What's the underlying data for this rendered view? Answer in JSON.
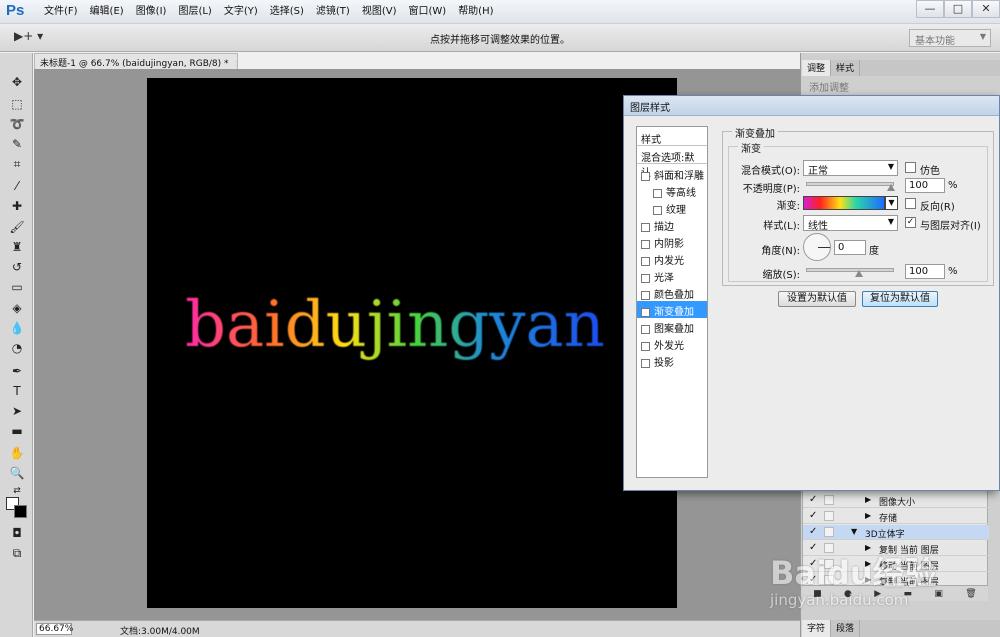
{
  "app": {
    "logo": "Ps",
    "menus": [
      "文件(F)",
      "编辑(E)",
      "图像(I)",
      "图层(L)",
      "文字(Y)",
      "选择(S)",
      "滤镜(T)",
      "视图(V)",
      "窗口(W)",
      "帮助(H)"
    ],
    "window_controls": [
      "—",
      "□",
      "✕"
    ]
  },
  "options_bar": {
    "move_tool": "▶+ ▾",
    "hint": "点按并拖移可调整效果的位置。",
    "workspace": "基本功能"
  },
  "document": {
    "tab_title": "未标题-1 @ 66.7% (baidujingyan, RGB/8) *",
    "canvas_text": "baidujingyan",
    "zoom": "66.67%",
    "doc_info": "文档:3.00M/4.00M"
  },
  "panels": {
    "top_tabs": [
      "调整",
      "样式"
    ],
    "add_adjustment": "添加调整",
    "bottom_tabs": [
      "字符",
      "段落"
    ]
  },
  "actions": {
    "rows": [
      {
        "label": "图像大小",
        "checked": "✓",
        "indent": "1"
      },
      {
        "label": "存储",
        "checked": "✓",
        "indent": "1"
      },
      {
        "label": "3D立体字",
        "checked": "✓",
        "indent": "0"
      },
      {
        "label": "复制 当前 图层",
        "checked": "✓",
        "indent": "1"
      },
      {
        "label": "移动 当前 图层",
        "checked": "✓",
        "indent": "1"
      },
      {
        "label": "复制 当前 图层",
        "checked": "✓",
        "indent": "1"
      }
    ],
    "toolbar_icons": [
      "■",
      "●",
      "▶",
      "▬",
      "▣",
      "🗑"
    ]
  },
  "dialog": {
    "title": "图层样式",
    "list_header": "样式",
    "blend_options": "混合选项:默认",
    "effects": [
      {
        "label": "斜面和浮雕",
        "checked": false,
        "sub": false
      },
      {
        "label": "等高线",
        "checked": false,
        "sub": true
      },
      {
        "label": "纹理",
        "checked": false,
        "sub": true
      },
      {
        "label": "描边",
        "checked": false,
        "sub": false
      },
      {
        "label": "内阴影",
        "checked": false,
        "sub": false
      },
      {
        "label": "内发光",
        "checked": false,
        "sub": false
      },
      {
        "label": "光泽",
        "checked": false,
        "sub": false
      },
      {
        "label": "颜色叠加",
        "checked": false,
        "sub": false
      },
      {
        "label": "渐变叠加",
        "checked": true,
        "sub": false
      },
      {
        "label": "图案叠加",
        "checked": false,
        "sub": false
      },
      {
        "label": "外发光",
        "checked": false,
        "sub": false
      },
      {
        "label": "投影",
        "checked": false,
        "sub": false
      }
    ],
    "group_title": "渐变叠加",
    "subgroup_title": "渐变",
    "blend_mode_label": "混合模式(O):",
    "blend_mode_value": "正常",
    "dither_label": "仿色",
    "opacity_label": "不透明度(P):",
    "opacity_value": "100",
    "opacity_unit": "%",
    "gradient_label": "渐变:",
    "reverse_label": "反向(R)",
    "style_label": "样式(L):",
    "style_value": "线性",
    "align_label": "与图层对齐(I)",
    "align_checked": "✓",
    "angle_label": "角度(N):",
    "angle_value": "0",
    "angle_unit": "度",
    "scale_label": "缩放(S):",
    "scale_value": "100",
    "scale_unit": "%",
    "make_default": "设置为默认值",
    "reset_default": "复位为默认值"
  },
  "watermark": {
    "logo": "Baidu经验",
    "url": "jingyan.baidu.com"
  },
  "colors": {
    "accent": "#3399ff",
    "canvas": "#000000"
  }
}
